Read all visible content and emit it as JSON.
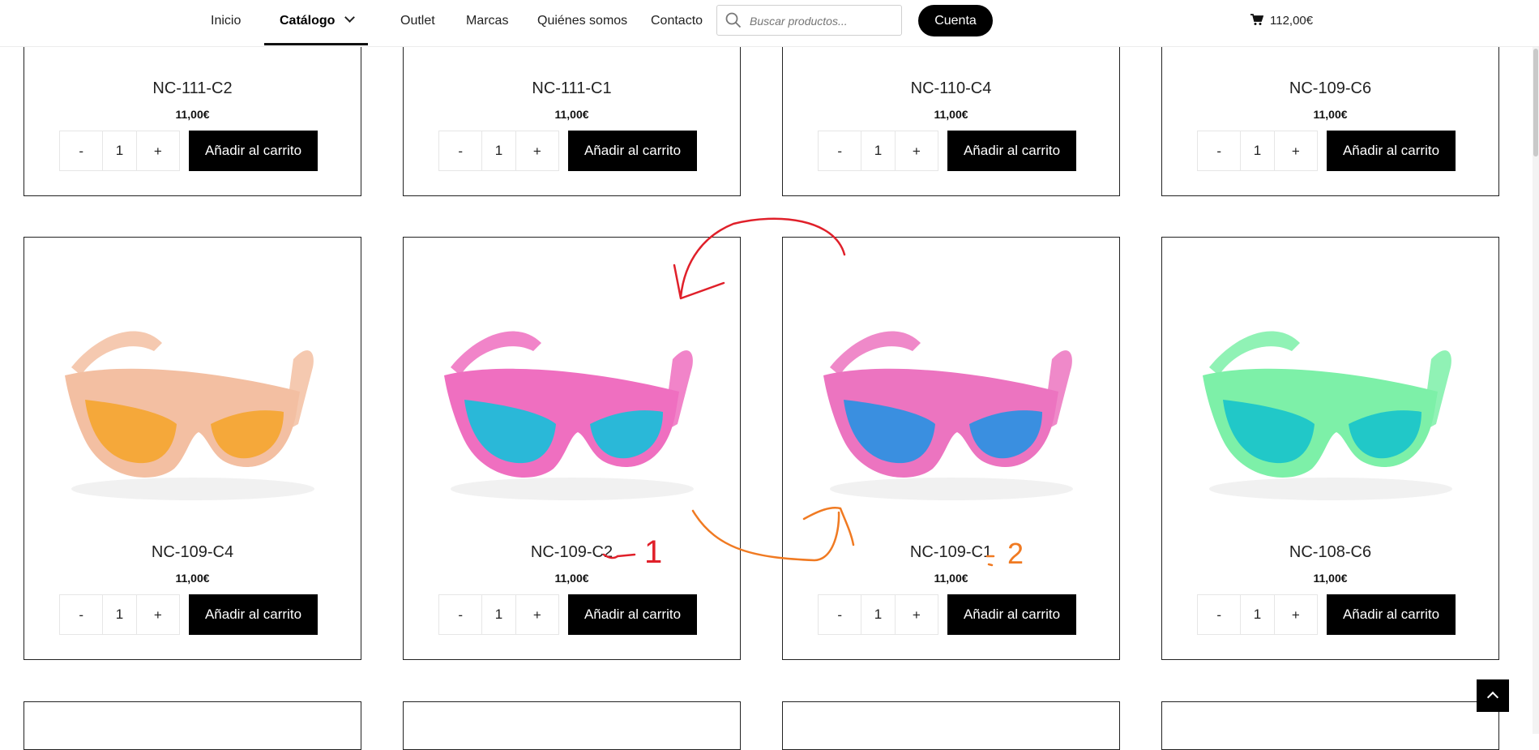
{
  "nav": {
    "items": [
      {
        "label": "Inicio"
      },
      {
        "label": "Catálogo"
      },
      {
        "label": "Outlet"
      },
      {
        "label": "Marcas"
      },
      {
        "label": "Quiénes somos"
      },
      {
        "label": "Contacto"
      }
    ],
    "search_placeholder": "Buscar productos...",
    "account_label": "Cuenta",
    "cart_total": "112,00€"
  },
  "products": [
    {
      "name": "NC-111-C2",
      "price": "11,00€",
      "qty": "1",
      "add_label": "Añadir al carrito",
      "minus": "-",
      "plus": "+"
    },
    {
      "name": "NC-111-C1",
      "price": "11,00€",
      "qty": "1",
      "add_label": "Añadir al carrito",
      "minus": "-",
      "plus": "+"
    },
    {
      "name": "NC-110-C4",
      "price": "11,00€",
      "qty": "1",
      "add_label": "Añadir al carrito",
      "minus": "-",
      "plus": "+"
    },
    {
      "name": "NC-109-C6",
      "price": "11,00€",
      "qty": "1",
      "add_label": "Añadir al carrito",
      "minus": "-",
      "plus": "+"
    },
    {
      "name": "NC-109-C4",
      "price": "11,00€",
      "qty": "1",
      "add_label": "Añadir al carrito",
      "minus": "-",
      "plus": "+",
      "frame_color": "#f3bfa2",
      "lens_color": "#f5a83a"
    },
    {
      "name": "NC-109-C2",
      "price": "11,00€",
      "qty": "1",
      "add_label": "Añadir al carrito",
      "minus": "-",
      "plus": "+",
      "frame_color": "#ef6fc0",
      "lens_color": "#2ab8d8"
    },
    {
      "name": "NC-109-C1",
      "price": "11,00€",
      "qty": "1",
      "add_label": "Añadir al carrito",
      "minus": "-",
      "plus": "+",
      "frame_color": "#ec74c0",
      "lens_color": "#3a8fe0"
    },
    {
      "name": "NC-108-C6",
      "price": "11,00€",
      "qty": "1",
      "add_label": "Añadir al carrito",
      "minus": "-",
      "plus": "+",
      "frame_color": "#7df0a8",
      "lens_color": "#21c8c8"
    }
  ],
  "annotations": {
    "red_label": "1",
    "orange_label": "2",
    "red_color": "#e0202a",
    "orange_color": "#f07a22"
  }
}
